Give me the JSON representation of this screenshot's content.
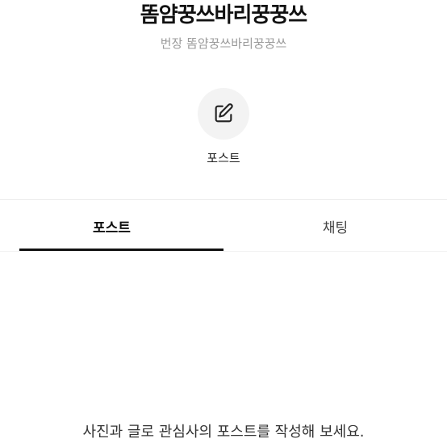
{
  "header": {
    "title": "똠얌꿍쓰바리꿍꿍쓰",
    "subtitle": "번장 똠얌꿍쓰바리꿍꿍쓰"
  },
  "action": {
    "icon": "edit-icon",
    "label": "포스트"
  },
  "tabs": [
    {
      "label": "포스트",
      "active": true
    },
    {
      "label": "채팅",
      "active": false
    }
  ],
  "empty_state": {
    "message": "사진과 글로 관심사의 포스트를 작성해 보세요."
  }
}
